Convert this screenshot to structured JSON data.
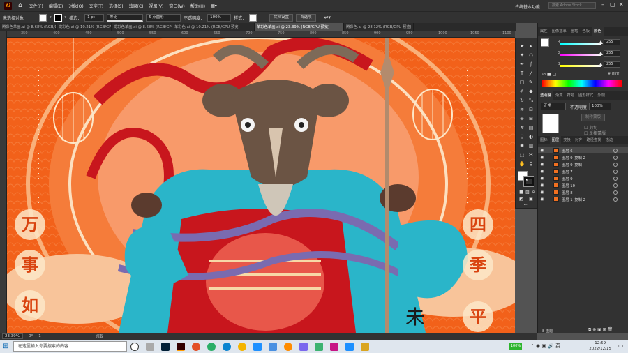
{
  "menubar": {
    "logo": "Ai",
    "items": [
      "文件(F)",
      "编辑(E)",
      "对象(O)",
      "文字(T)",
      "选择(S)",
      "效果(C)",
      "视图(V)",
      "窗口(W)",
      "帮助(H)"
    ],
    "workspace": "传统基本功能",
    "search_placeholder": "搜索 Adobe Stock"
  },
  "control": {
    "selection_status": "未选择对象",
    "stroke_label": "描边：",
    "stroke_value": "1 pt",
    "stroke_profile": "等比",
    "brush": "5 点圆形",
    "opacity_label": "不透明度：",
    "opacity_value": "100%",
    "style_label": "样式：",
    "doc_setup": "文档设置",
    "preferences": "首选项"
  },
  "tabs": [
    {
      "label": "腾彩色羊画.ai @ 8.68% (RGB/GPU 预览)",
      "active": false
    },
    {
      "label": "龙彩色.ai @ 10.21% (RGB/GPU 预览)",
      "active": false
    },
    {
      "label": "龙彩色羊画.ai @ 8.68% (RGB/GPU 预览)",
      "active": false
    },
    {
      "label": "羊彩色.ai @ 10.21% (RGB/GPU 预览)",
      "active": false
    },
    {
      "label": "羊彩色羊画.ai @ 23.39% (RGB/GPU 预览)",
      "active": true
    },
    {
      "label": "腾彩色.ai @ 28.12% (RGB/GPU 预览)",
      "active": false
    }
  ],
  "ruler_ticks": [
    "350",
    "400",
    "450",
    "500",
    "550",
    "600",
    "650",
    "700",
    "750",
    "800",
    "850",
    "900",
    "950",
    "1000",
    "1050",
    "1100"
  ],
  "canvas": {
    "left_chars": [
      "万",
      "事",
      "如"
    ],
    "right_chars": [
      "四",
      "季",
      "平"
    ],
    "seal_char": "未",
    "colors": {
      "background": "#f2611a",
      "teal": "#2ab5c9",
      "red": "#c8161d",
      "purple": "#7a6bb0",
      "cream": "#f7d9a7"
    }
  },
  "status": {
    "zoom": "23.39%",
    "angle": "0°",
    "artboard": "1",
    "mode": "抓取"
  },
  "color_panel": {
    "tabs": [
      "属性",
      "图像描摹",
      "画笔",
      "色板",
      "颜色"
    ],
    "channels": [
      {
        "label": "R",
        "value": "255",
        "fraction": 1.0
      },
      {
        "label": "G",
        "value": "255",
        "fraction": 1.0
      },
      {
        "label": "B",
        "value": "255",
        "fraction": 1.0
      }
    ],
    "hex": "ffffff"
  },
  "transparency_panel": {
    "tabs": [
      "透明度",
      "渐变",
      "符号",
      "图形样式",
      "外观"
    ],
    "blend_mode": "正常",
    "opacity_label": "不透明度：",
    "opacity_value": "100%",
    "make_mask": "制作蒙版",
    "clip": "剪切",
    "invert_mask": "反相蒙版"
  },
  "layers_panel": {
    "tabs": [
      "图标",
      "图层",
      "变换",
      "对齐",
      "路径查找",
      "描边"
    ],
    "layers": [
      "图层 6",
      "图层 9_复制 2",
      "图层 9_复制",
      "图层 7",
      "图层 9",
      "图层 10",
      "图层 8",
      "图层 1_复制 2"
    ],
    "footer": "8 图层"
  },
  "taskbar": {
    "search_placeholder": "在这里输入你要搜索的内容",
    "battery": "100%",
    "time": "12:59",
    "date": "2022/12/15"
  }
}
